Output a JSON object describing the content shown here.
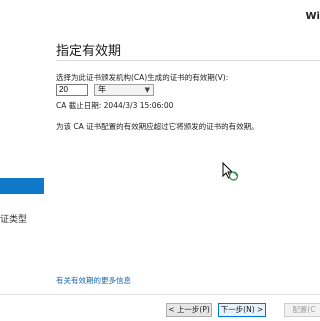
{
  "header": {
    "brand": "Wi"
  },
  "sidebar": {
    "items": [
      {
        "label": "",
        "active": true
      },
      {
        "label": "证类型",
        "active": false
      }
    ]
  },
  "main": {
    "title": "指定有效期",
    "validity": {
      "label": "选择为此证书颁发机构(CA)生成的证书的有效期(V):",
      "value": "20",
      "unit": "年"
    },
    "expiry_text": "CA 截止日期: 2044/3/3 15:06:00",
    "note": "为该 CA 证书配置的有效期应超过它将颁发的证书的有效期。",
    "more_link": "有关有效期的更多信息"
  },
  "footer": {
    "prev_label": "< 上一步(P)",
    "next_label": "下一步(N) >",
    "config_label": "配置(C"
  },
  "colors": {
    "accent": "#0f78c9",
    "link": "#1a65b5"
  }
}
